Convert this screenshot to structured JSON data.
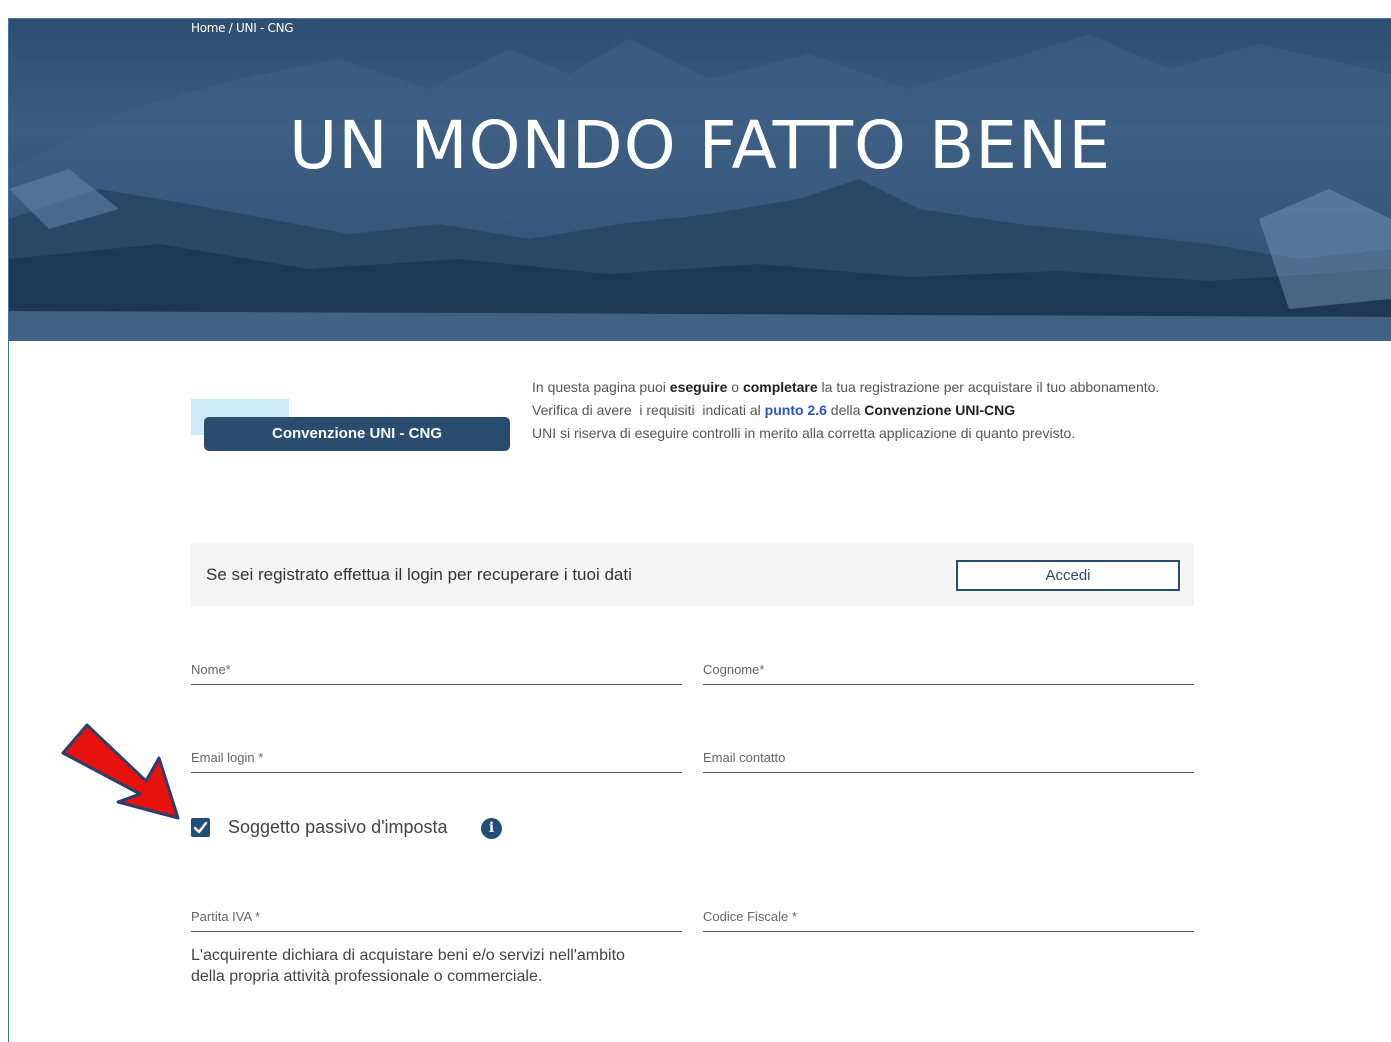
{
  "breadcrumb": {
    "home": "Home",
    "separator": "/",
    "current": "UNI - CNG"
  },
  "hero": {
    "title": "UN MONDO FATTO BENE"
  },
  "badge": {
    "label": "Convenzione UNI - CNG"
  },
  "intro": {
    "l1_a": "In questa pagina puoi ",
    "l1_b": "eseguire",
    "l1_c": " o ",
    "l1_d": "completare",
    "l1_e": " la tua registrazione per acquistare il tuo abbonamento.",
    "l2_a": "Verifica di avere  i requisiti  indicati al ",
    "l2_link": "punto 2.6",
    "l2_b": " della ",
    "l2_c": "Convenzione UNI-CNG",
    "l3": "UNI si riserva di eseguire controlli in merito alla corretta applicazione di quanto previsto."
  },
  "login": {
    "text": "Se sei registrato effettua il login per recuperare i tuoi dati",
    "button": "Accedi"
  },
  "form": {
    "nome": "Nome*",
    "cognome": "Cognome*",
    "email_login": "Email login *",
    "email_contatto": "Email contatto",
    "soggetto_passivo": "Soggetto passivo d'imposta",
    "soggetto_passivo_checked": true,
    "info_icon": "i",
    "partita_iva": "Partita IVA *",
    "codice_fiscale": "Codice Fiscale *",
    "note": "L'acquirente dichiara di acquistare beni e/o servizi nell'ambito della propria attività professionale o commerciale."
  },
  "colors": {
    "primary": "#2a4c6e",
    "link": "#2a55c7",
    "arrow": "#e8120c",
    "checkbox": "#1f4f78"
  }
}
